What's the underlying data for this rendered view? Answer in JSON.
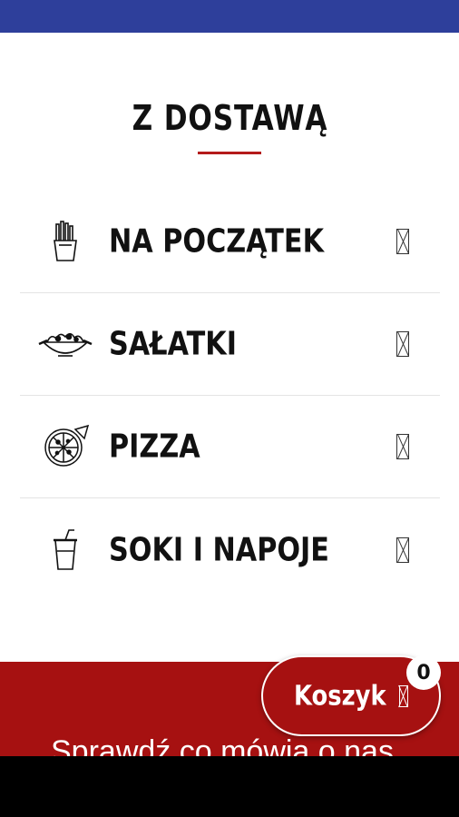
{
  "page": {
    "title": "Z DOSTAWĄ"
  },
  "menu": {
    "items": [
      {
        "label": "NA POCZĄTEK",
        "icon": "fries-icon"
      },
      {
        "label": "SAŁATKI",
        "icon": "salad-bowl-icon"
      },
      {
        "label": "PIZZA",
        "icon": "pizza-icon"
      },
      {
        "label": "SOKI I NAPOJE",
        "icon": "drink-cup-icon"
      }
    ],
    "chevron_icon": "chevron-right-icon"
  },
  "cart": {
    "label": "Koszyk",
    "count": "0",
    "icon": "cart-icon"
  },
  "footer": {
    "text": "Sprawdź co mówią o nas"
  },
  "colors": {
    "status_bar": "#2e3f9b",
    "accent_red": "#a61111",
    "underline_red": "#b41a1a"
  }
}
